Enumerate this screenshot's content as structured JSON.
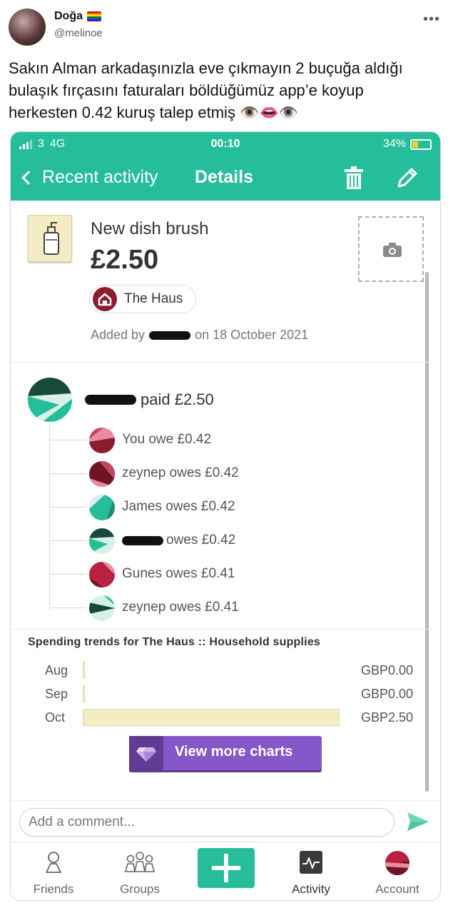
{
  "tweet": {
    "display_name": "Doğa",
    "handle": "@melinoe",
    "text": "Sakın Alman arkadaşınızla eve çıkmayın 2 buçuğa aldığı bulaşık fırçasını faturaları böldüğümüz app’e koyup herkesten 0.42 kuruş talep etmiş 👁️👄👁️"
  },
  "status_bar": {
    "carrier": "3",
    "network": "4G",
    "time": "00:10",
    "battery": "34%"
  },
  "nav": {
    "back_label": "Recent activity",
    "title": "Details"
  },
  "expense": {
    "name": "New dish brush",
    "amount": "£2.50",
    "group": "The Haus",
    "added_prefix": "Added by",
    "added_suffix": "on 18 October 2021"
  },
  "payer": {
    "text": "paid £2.50"
  },
  "debts": [
    {
      "label": "You owe £0.42"
    },
    {
      "label": "zeynep owes £0.42"
    },
    {
      "label": "James owes £0.42"
    },
    {
      "label": "owes £0.42"
    },
    {
      "label": "Gunes owes £0.41"
    },
    {
      "label": "zeynep owes £0.41"
    }
  ],
  "trends": {
    "title": "Spending trends for The Haus :: Household supplies",
    "rows": [
      {
        "month": "Aug",
        "value": "GBP0.00",
        "amount": 0
      },
      {
        "month": "Sep",
        "value": "GBP0.00",
        "amount": 0
      },
      {
        "month": "Oct",
        "value": "GBP2.50",
        "amount": 2.5
      }
    ],
    "button_label": "View more charts"
  },
  "comment": {
    "placeholder": "Add a comment..."
  },
  "tabs": {
    "friends": "Friends",
    "groups": "Groups",
    "activity": "Activity",
    "account": "Account"
  },
  "colors": {
    "brand": "#26be9a",
    "purple": "#8657c9",
    "bar": "#f3ecc4"
  }
}
